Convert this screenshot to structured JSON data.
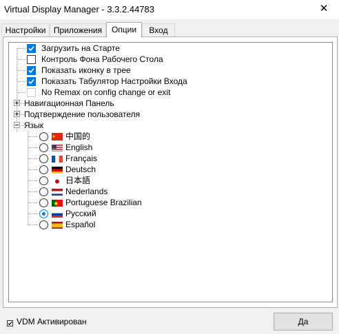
{
  "window": {
    "title": "Virtual Display Manager - 3.3.2.44783",
    "close_glyph": "✕"
  },
  "tabs": [
    {
      "label": "Настройки",
      "active": false
    },
    {
      "label": "Приложения",
      "active": false
    },
    {
      "label": "Опции",
      "active": true
    },
    {
      "label": "Вход",
      "active": false
    }
  ],
  "options": [
    {
      "label": "Загрузить на Старте",
      "checked": true
    },
    {
      "label": "Контроль Фона Рабочего Стола",
      "checked": false
    },
    {
      "label": "Показать иконку в трее",
      "checked": true
    },
    {
      "label": "Показать Табулятор Настройки Входа",
      "checked": true
    },
    {
      "label": "No Remax on config change or exit",
      "checked": false,
      "disabled": true
    }
  ],
  "groups": [
    {
      "label": "Навигационная Панель",
      "expanded": false
    },
    {
      "label": "Подтверждение пользователя",
      "expanded": false
    },
    {
      "label": "Язык",
      "expanded": true
    }
  ],
  "languages": [
    {
      "label": "中国的",
      "flag": "cn-flag",
      "selected": false
    },
    {
      "label": "English",
      "flag": "us-flag",
      "selected": false
    },
    {
      "label": "Français",
      "flag": "fr-flag",
      "selected": false
    },
    {
      "label": "Deutsch",
      "flag": "de-flag",
      "selected": false
    },
    {
      "label": "日本語",
      "flag": "jp-flag",
      "selected": false
    },
    {
      "label": "Nederlands",
      "flag": "nl-flag",
      "selected": false
    },
    {
      "label": "Portuguese Brazilian",
      "flag": "pt-flag",
      "selected": false
    },
    {
      "label": "Русский",
      "flag": "ru-flag",
      "selected": true
    },
    {
      "label": "Español",
      "flag": "es-flag",
      "selected": false
    }
  ],
  "footer": {
    "vdm_label": "VDM Активирован",
    "vdm_checked": true,
    "ok_label": "Да"
  },
  "colors": {
    "accent": "#0078d7"
  }
}
